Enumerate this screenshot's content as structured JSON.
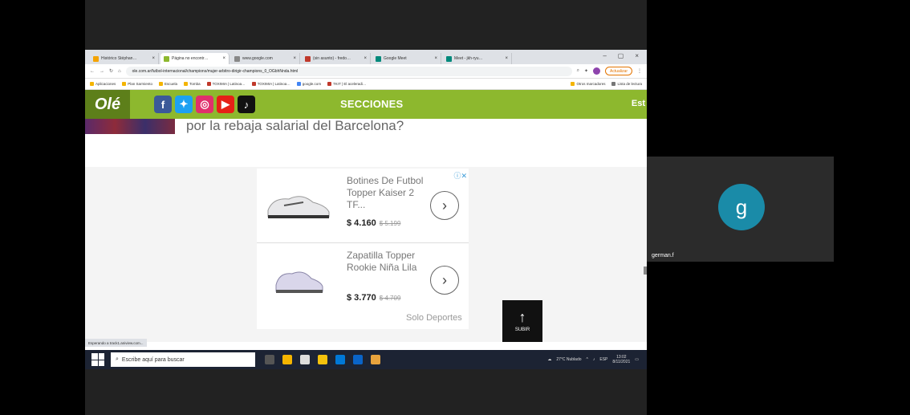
{
  "browser": {
    "tabs": [
      {
        "label": "Histórico Stéphan…",
        "color": "#f4a300"
      },
      {
        "label": "Página no encontr…",
        "color": "#8db82e",
        "active": true
      },
      {
        "label": "www.google.com",
        "color": "#888888"
      },
      {
        "label": "(sin asunto) - fredo…",
        "color": "#c0392b"
      },
      {
        "label": "Google Meet",
        "color": "#00897b"
      },
      {
        "label": "Meet - jkh-ryu…",
        "color": "#00897b"
      }
    ],
    "url": "ole.com.ar/futbol-internacional/champions/mujer-arbitro-dirigir-champions_0_OGbhNnda.html",
    "update_label": "Actualizar",
    "bookmarks": [
      "Aplicaciones",
      "Plan Sarmiento",
      "Escuela",
      "Tomba",
      "TOXIMIA | Latinoa…",
      "TOXIMIA | Latinoa…",
      "google.com",
      "TKIT | El aceleradi…",
      "Otros marcadores",
      "Lista de lectura"
    ],
    "status_text": "Esperando a track1.aniview.com..."
  },
  "site": {
    "logo": "Olé",
    "secciones_label": "SECCIONES",
    "est_label": "Est",
    "headline": "por la rebaja salarial del Barcelona?"
  },
  "ad": {
    "products": [
      {
        "name": "Botines De Futbol Topper Kaiser 2 TF...",
        "price": "$ 4.160",
        "old_price": "$ 5.199"
      },
      {
        "name": "Zapatilla Topper Rookie Niña Lila",
        "price": "$ 3.770",
        "old_price": "$ 4.709"
      }
    ],
    "brand": "Solo Deportes",
    "subir_label": "SUBIR"
  },
  "taskbar": {
    "search_placeholder": "Escribe aquí para buscar",
    "weather": "27°C Nublado",
    "lang": "ESP",
    "time": "13:02",
    "date": "8/11/2021"
  },
  "meet": {
    "avatar_letter": "g",
    "participant_name": "german.f"
  }
}
